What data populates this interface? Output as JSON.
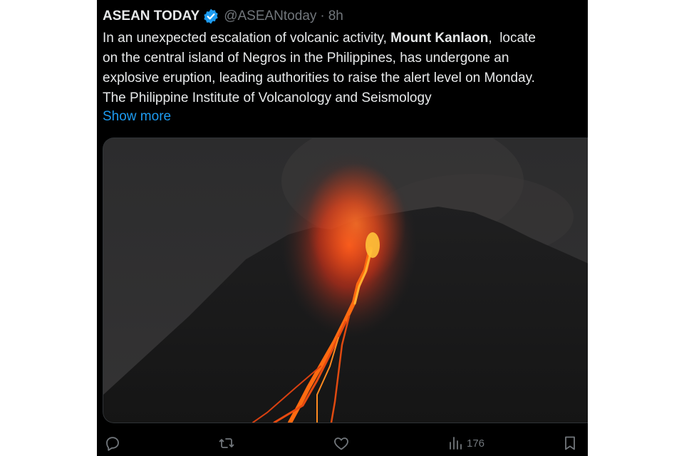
{
  "tweet": {
    "author_name": "ASEAN TODAY",
    "handle": "@ASEANtoday",
    "separator": "·",
    "time": "8h",
    "text": {
      "line1_pre": "In an unexpected escalation of volcanic activity, ",
      "line1_bold": "Mount Kanlaon",
      "line1_post": ",  locate",
      "line2": "on the central island of Negros in the Philippines, has undergone an",
      "line3": "explosive eruption, leading authorities to raise the alert level on Monday.",
      "line4": "The Philippine Institute of Volcanology and Seismology"
    },
    "show_more": "Show more",
    "actions": {
      "views_count": "176"
    },
    "icons": {
      "verified": "verified-badge-icon",
      "reply": "reply-icon",
      "retweet": "retweet-icon",
      "like": "heart-icon",
      "views": "views-bar-chart-icon",
      "bookmark": "bookmark-icon"
    },
    "colors": {
      "background": "#000000",
      "text": "#e7e9ea",
      "secondary_text": "#71767b",
      "link": "#1d9bf0",
      "verified": "#1d9bf0"
    }
  }
}
